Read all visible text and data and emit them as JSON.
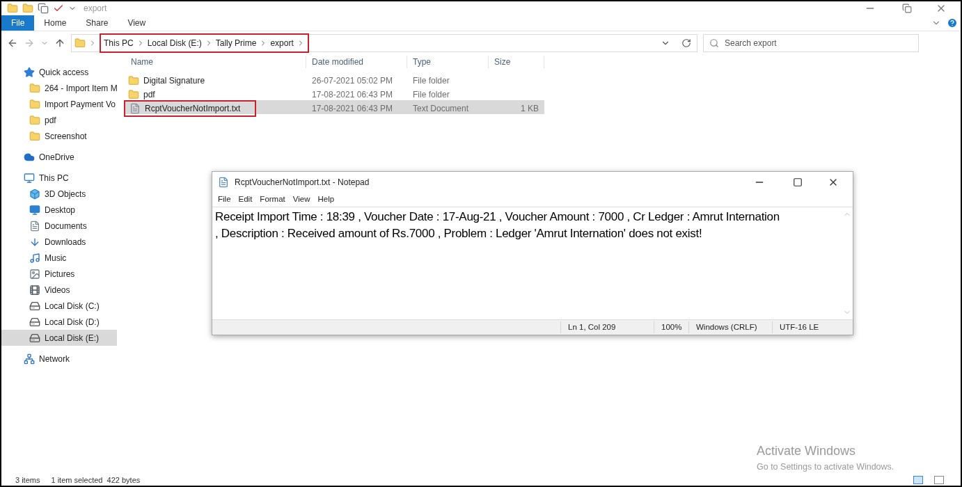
{
  "window": {
    "title": "export"
  },
  "ribbon_tabs": [
    {
      "label": "File",
      "selected": true
    },
    {
      "label": "Home",
      "selected": false
    },
    {
      "label": "Share",
      "selected": false
    },
    {
      "label": "View",
      "selected": false
    }
  ],
  "address_bar": {
    "crumbs": [
      "This PC",
      "Local Disk (E:)",
      "Tally Prime",
      "export"
    ],
    "highlighted": true
  },
  "search": {
    "placeholder": "Search export"
  },
  "sidebar": [
    {
      "label": "Quick access",
      "kind": "star",
      "selected": false,
      "children": [
        {
          "label": "264 - Import Item M",
          "kind": "folder",
          "selected": false
        },
        {
          "label": "Import Payment Vo",
          "kind": "folder",
          "selected": false
        },
        {
          "label": "pdf",
          "kind": "folder",
          "selected": false
        },
        {
          "label": "Screenshot",
          "kind": "folder",
          "selected": false
        }
      ]
    },
    {
      "label": "OneDrive",
      "kind": "cloud",
      "selected": false
    },
    {
      "label": "This PC",
      "kind": "pc",
      "selected": false,
      "children": [
        {
          "label": "3D Objects",
          "kind": "cube",
          "selected": false
        },
        {
          "label": "Desktop",
          "kind": "desktop",
          "selected": false
        },
        {
          "label": "Documents",
          "kind": "document",
          "selected": false
        },
        {
          "label": "Downloads",
          "kind": "download",
          "selected": false
        },
        {
          "label": "Music",
          "kind": "music",
          "selected": false
        },
        {
          "label": "Pictures",
          "kind": "pictures",
          "selected": false
        },
        {
          "label": "Videos",
          "kind": "videos",
          "selected": false
        },
        {
          "label": "Local Disk (C:)",
          "kind": "disk",
          "selected": false
        },
        {
          "label": "Local Disk (D:)",
          "kind": "disk",
          "selected": false
        },
        {
          "label": "Local Disk (E:)",
          "kind": "disk",
          "selected": true
        }
      ]
    },
    {
      "label": "Network",
      "kind": "network",
      "selected": false
    }
  ],
  "table": {
    "columns": [
      "Name",
      "Date modified",
      "Type",
      "Size"
    ],
    "rows": [
      {
        "name": "Digital Signature",
        "date": "26-07-2021 05:02 PM",
        "type": "File folder",
        "kind": "folder",
        "selected": false,
        "highlighted": false
      },
      {
        "name": "pdf",
        "date": "17-08-2021 06:43 PM",
        "type": "File folder",
        "kind": "folder",
        "selected": false,
        "highlighted": false
      },
      {
        "name": "RcptVoucherNotImport.txt",
        "date": "17-08-2021 06:43 PM",
        "type": "Text Document",
        "size": "1 KB",
        "kind": "text",
        "selected": true,
        "highlighted": true
      }
    ]
  },
  "notepad": {
    "title": "RcptVoucherNotImport.txt - Notepad",
    "menu": [
      "File",
      "Edit",
      "Format",
      "View",
      "Help"
    ],
    "lines": [
      "Receipt Import Time : 18:39 , Voucher Date : 17-Aug-21 , Voucher Amount : 7000 , Cr Ledger : Amrut Internation",
      ", Description : Received amount of Rs.7000 , Problem : Ledger 'Amrut Internation' does not exist!"
    ],
    "status": [
      "Ln 1, Col 209",
      "100%",
      "Windows (CRLF)",
      "UTF-16 LE"
    ]
  },
  "activation": {
    "title": "Activate Windows",
    "text": "Go to Settings to activate Windows."
  },
  "status_bar": [
    "3 items",
    "1 item selected  422 bytes"
  ]
}
